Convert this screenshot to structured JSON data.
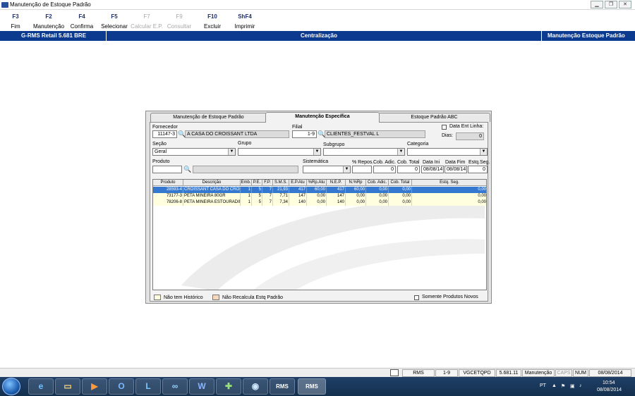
{
  "window": {
    "title": "Manutenção de Estoque Padrão"
  },
  "toolbar": [
    {
      "key": "F3",
      "label": "Fim",
      "enabled": true
    },
    {
      "key": "F2",
      "label": "Manutenção",
      "enabled": true
    },
    {
      "key": "F4",
      "label": "Confirma",
      "enabled": true
    },
    {
      "key": "F5",
      "label": "Selecionar",
      "enabled": true
    },
    {
      "key": "F7",
      "label": "Calcular E.P.",
      "enabled": false
    },
    {
      "key": "F9",
      "label": "Consultar",
      "enabled": false
    },
    {
      "key": "F10",
      "label": "Excluir",
      "enabled": true
    },
    {
      "key": "ShF4",
      "label": "Imprimir",
      "enabled": true
    }
  ],
  "bluebar": {
    "app": "G-RMS Retail 5.681 BRE",
    "center": "Centralização",
    "right": "Manutenção Estoque Padrão"
  },
  "tabs": [
    {
      "label": "Manutenção de Estoque Padrão",
      "active": false
    },
    {
      "label": "Manutenção Específica",
      "active": true
    },
    {
      "label": "Estoque Padrão ABC",
      "active": false
    }
  ],
  "form": {
    "fornecedor_label": "Fornecedor",
    "fornecedor_code": "11147-3",
    "fornecedor_name": "A CASA DO CROISSANT LTDA",
    "filial_label": "Filial",
    "filial_code": "1-9",
    "filial_name": "CLIENTES_FESTVAL L",
    "data_ent_linha_label": "Data Ent Linha:",
    "dias_label": "Dias:",
    "dias_value": "0",
    "secao_label": "Seção",
    "secao_value": "Geral",
    "grupo_label": "Grupo",
    "grupo_value": "",
    "subgrupo_label": "Subgrupo",
    "subgrupo_value": "",
    "categoria_label": "Categoria",
    "categoria_value": "",
    "produto_label": "Produto",
    "produto_code": "",
    "produto_name": "",
    "sistematica_label": "Sistemática",
    "sistematica_value": "",
    "repos_label": "% Repos.",
    "repos_value": "",
    "cob_adic_label": "Cob. Adic.",
    "cob_adic_value": "0",
    "cob_total_label": "Cob. Total",
    "cob_total_value": "0",
    "data_ini_label": "Data Ini",
    "data_ini_value": "08/08/14",
    "data_fim_label": "Data Fim",
    "data_fim_value": "08/08/14",
    "estq_seg_label": "Estq.Seg.",
    "estq_seg_value": "0"
  },
  "grid": {
    "headers": [
      "Produto",
      "Descrição",
      "Emb.",
      "P.E.",
      "F.P.",
      "S.M.S.",
      "E.P.Atu",
      "%Rp.Atu",
      "N.E.P.",
      "N.%Rp",
      "Cob. Adic.",
      "Cob. Total",
      "Estq. Seg."
    ],
    "rows": [
      [
        "28593-4",
        "CROISSANT CASA DO CROISS",
        "1",
        "5",
        "7",
        "21,93",
        "417",
        "60,00",
        "417",
        "60,00",
        "0,00",
        "0,00",
        "0,00"
      ],
      [
        "73177-3",
        "PETA MINEIRA 80GR",
        "1",
        "5",
        "7",
        "7,71",
        "147",
        "0,00",
        "147",
        "0,00",
        "0,00",
        "0,00",
        "0,00"
      ],
      [
        "78206-8",
        "PETA MINEIRA ESTOURADINHC",
        "1",
        "5",
        "7",
        "7,34",
        "140",
        "0,00",
        "140",
        "0,00",
        "0,00",
        "0,00",
        "0,00"
      ]
    ],
    "selected_row": 0
  },
  "legend": {
    "no_history": "Não tem Histórico",
    "no_recalc": "Não Recalcula Estq Padrão",
    "only_new": "Somente Produtos Novos"
  },
  "colors": {
    "no_history": "#ffffe0",
    "no_recalc": "#f8d8b8",
    "selected": "#3478d0",
    "blue_bar": "#0b3a8f"
  },
  "status": [
    "RMS",
    "1-9",
    "VGCETQPD",
    "5.681.11",
    "Manutenção",
    "CAPS",
    "NUM",
    "08/08/2014"
  ],
  "taskbar": {
    "app1": "RMS",
    "app2": "RMS",
    "lang": "PT",
    "time": "10:54",
    "date": "08/08/2014"
  }
}
